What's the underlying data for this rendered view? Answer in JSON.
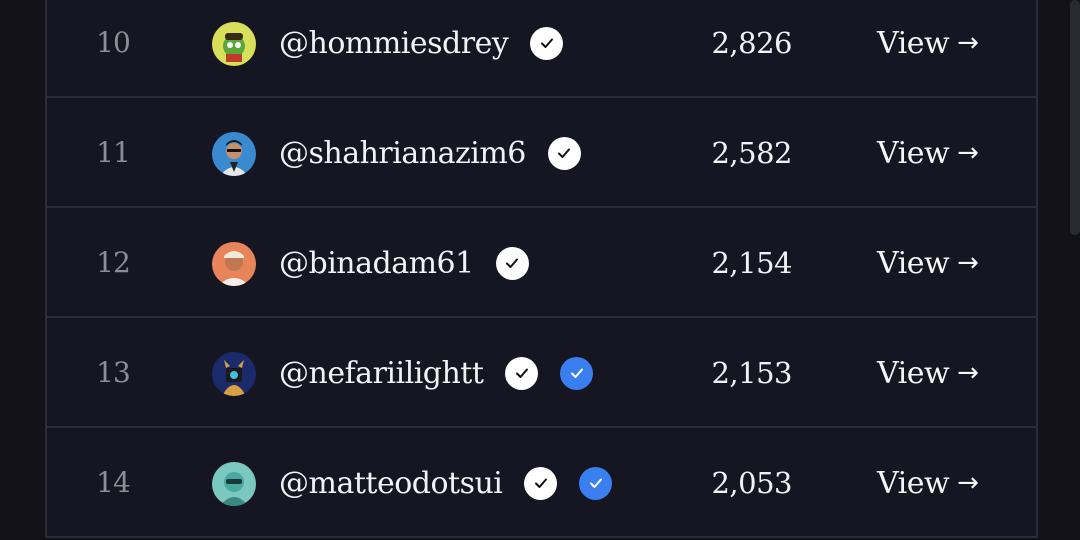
{
  "leaderboard": {
    "rows": [
      {
        "rank": "10",
        "handle": "@hommiesdrey",
        "score": "2,826",
        "view_label": "View",
        "verified": true,
        "blue_check": false
      },
      {
        "rank": "11",
        "handle": "@shahrianazim6",
        "score": "2,582",
        "view_label": "View",
        "verified": true,
        "blue_check": false
      },
      {
        "rank": "12",
        "handle": "@binadam61",
        "score": "2,154",
        "view_label": "View",
        "verified": true,
        "blue_check": false
      },
      {
        "rank": "13",
        "handle": "@nefariilightt",
        "score": "2,153",
        "view_label": "View",
        "verified": true,
        "blue_check": true
      },
      {
        "rank": "14",
        "handle": "@matteodotsui",
        "score": "2,053",
        "view_label": "View",
        "verified": true,
        "blue_check": true
      }
    ]
  },
  "colors": {
    "background": "#121218",
    "row_background": "#161622",
    "divider": "#2c2c38",
    "rank_text": "#8d8d96",
    "primary_text": "#f2f2f6",
    "blue_badge": "#3a7ff0"
  },
  "icons": {
    "verified": "check-circle-icon",
    "blue_verified": "blue-check-icon",
    "view_arrow": "arrow-right-icon"
  }
}
